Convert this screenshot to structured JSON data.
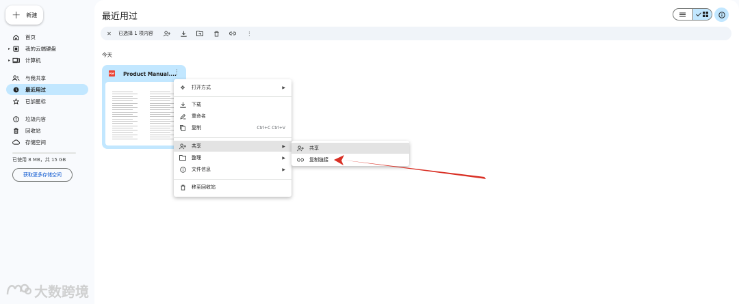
{
  "sidebar": {
    "new_label": "新建",
    "items": [
      {
        "label": "首页",
        "icon": "home-icon"
      },
      {
        "label": "我的云端硬盘",
        "icon": "drive-icon"
      },
      {
        "label": "计算机",
        "icon": "computer-icon"
      },
      {
        "label": "与我共享",
        "icon": "shared-icon"
      },
      {
        "label": "最近用过",
        "icon": "clock-icon",
        "active": true
      },
      {
        "label": "已加星标",
        "icon": "star-icon"
      },
      {
        "label": "垃圾内容",
        "icon": "spam-icon"
      },
      {
        "label": "回收站",
        "icon": "trash-icon"
      },
      {
        "label": "存储空间",
        "icon": "cloud-icon"
      }
    ],
    "storage_text": "已使用 8 MB，共 15 GB",
    "storage_button": "获取更多存储空间"
  },
  "header": {
    "title": "最近用过"
  },
  "selection_bar": {
    "text": "已选择 1 项内容"
  },
  "section": {
    "label": "今天"
  },
  "file": {
    "name": "Product Manual....",
    "type_badge": "PDF"
  },
  "context_menu": {
    "items": [
      {
        "label": "打开方式",
        "icon": "open-with-icon",
        "submenu": true
      },
      {
        "label": "下载",
        "icon": "download-icon"
      },
      {
        "label": "重命名",
        "icon": "rename-icon"
      },
      {
        "label": "复制",
        "icon": "copy-icon",
        "shortcut": "Ctrl+C Ctrl+V"
      },
      {
        "label": "共享",
        "icon": "share-icon",
        "submenu": true,
        "highlighted": true
      },
      {
        "label": "整理",
        "icon": "folder-icon",
        "submenu": true
      },
      {
        "label": "文件信息",
        "icon": "info-icon",
        "submenu": true
      },
      {
        "label": "移至回收站",
        "icon": "trash-icon"
      }
    ]
  },
  "share_submenu": {
    "items": [
      {
        "label": "共享",
        "icon": "share-icon",
        "highlighted": true
      },
      {
        "label": "复制链接",
        "icon": "link-icon"
      }
    ]
  },
  "watermark": {
    "text": "大数跨境"
  },
  "colors": {
    "accent": "#c2e7ff",
    "annotation_arrow": "#d93025"
  }
}
